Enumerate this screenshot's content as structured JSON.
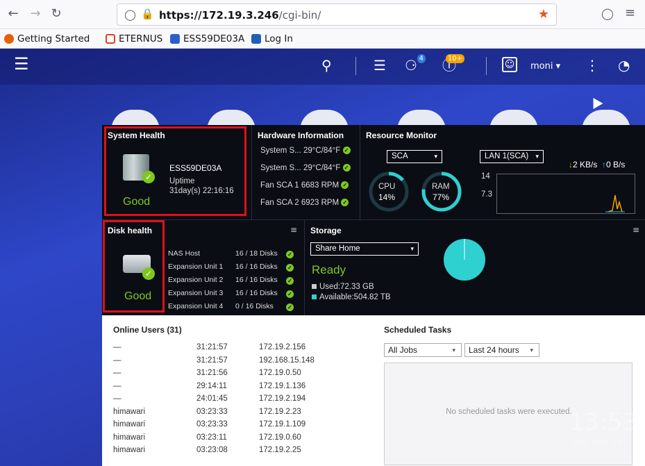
{
  "browser": {
    "url_host": "https://172.19.3.246",
    "url_path": "/cgi-bin/",
    "bookmarks": [
      "Getting Started",
      "ETERNUS",
      "ESS59DE03A",
      "Log In"
    ]
  },
  "qnap": {
    "notif_badge": "4",
    "info_badge": "10+",
    "user": "moni ▾",
    "clock_time": "13:53",
    "clock_date": "Tue, Apr 26"
  },
  "system_health": {
    "title": "System Health",
    "device": "ESS59DE03A",
    "uptime_label": "Uptime",
    "uptime_value": "31day(s) 22:16:16",
    "status": "Good"
  },
  "hardware": {
    "title": "Hardware Information",
    "rows": [
      {
        "label": "System S...",
        "value": "29°C/84°F"
      },
      {
        "label": "System S...",
        "value": "29°C/84°F"
      },
      {
        "label": "Fan SCA 1",
        "value": "6683 RPM"
      },
      {
        "label": "Fan SCA 2",
        "value": "6923 RPM"
      }
    ]
  },
  "resource": {
    "title": "Resource Monitor",
    "select_scope": "SCA",
    "select_lan": "LAN 1(SCA)",
    "download": "2 KB/s",
    "upload": "0 B/s",
    "cpu_label": "CPU",
    "cpu_value": "14%",
    "cpu_pct": 14,
    "ram_label": "RAM",
    "ram_value": "77%",
    "ram_pct": 77,
    "axis_top": "14",
    "axis_mid": "7.3"
  },
  "disk_health": {
    "title": "Disk health",
    "status": "Good",
    "rows": [
      {
        "label": "NAS Host",
        "value": "16 / 18 Disks"
      },
      {
        "label": "Expansion Unit 1",
        "value": "16 / 16 Disks"
      },
      {
        "label": "Expansion Unit 2",
        "value": "16 / 16 Disks"
      },
      {
        "label": "Expansion Unit 3",
        "value": "16 / 16 Disks"
      },
      {
        "label": "Expansion Unit 4",
        "value": "0 / 16 Disks"
      }
    ]
  },
  "storage": {
    "title": "Storage",
    "select": "Share Home",
    "status": "Ready",
    "used": "Used:72.33 GB",
    "available": "Available:504.82 TB"
  },
  "online_users": {
    "title": "Online Users (31)",
    "rows": [
      [
        "—",
        "31:21:57",
        "172.19.2.156"
      ],
      [
        "—",
        "31:21:57",
        "192.168.15.148"
      ],
      [
        "—",
        "31:21:56",
        "172.19.0.50"
      ],
      [
        "—",
        "29:14:11",
        "172.19.1.136"
      ],
      [
        "—",
        "24:01:45",
        "172.19.2.194"
      ],
      [
        "himawari",
        "03:23:33",
        "172.19.2.23"
      ],
      [
        "himawari",
        "03:23:33",
        "172.19.1.109"
      ],
      [
        "himawari",
        "03:23:11",
        "172.19.0.60"
      ],
      [
        "himawari",
        "03:23:08",
        "172.19.2.25"
      ]
    ]
  },
  "scheduled_tasks": {
    "title": "Scheduled Tasks",
    "filter_jobs": "All Jobs",
    "filter_time": "Last 24 hours",
    "empty_msg": "No scheduled tasks were executed."
  }
}
